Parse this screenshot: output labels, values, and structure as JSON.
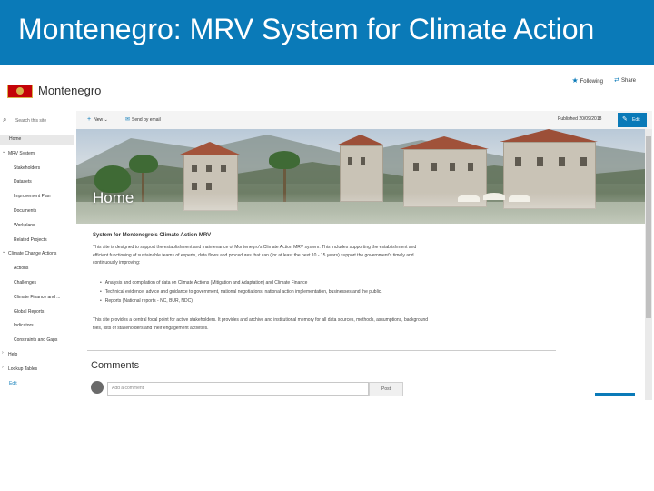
{
  "slide": {
    "title": "Montenegro: MRV System for Climate Action"
  },
  "site": {
    "name": "Montenegro"
  },
  "header": {
    "following_label": "Following",
    "share_label": "Share"
  },
  "nav": {
    "search_placeholder": "Search this site",
    "items": [
      {
        "label": "Home",
        "active": true
      },
      {
        "label": "MRV System",
        "expander": "-"
      },
      {
        "label": "Stakeholders"
      },
      {
        "label": "Datasets"
      },
      {
        "label": "Improvement Plan"
      },
      {
        "label": "Documents"
      },
      {
        "label": "Workplans"
      },
      {
        "label": "Related Projects"
      },
      {
        "label": "Climate Change Actions",
        "expander": "-"
      },
      {
        "label": "Actions"
      },
      {
        "label": "Challenges"
      },
      {
        "label": "Climate Finance and ..."
      },
      {
        "label": "Global Reports"
      },
      {
        "label": "Indicators"
      },
      {
        "label": "Constraints and Gaps"
      },
      {
        "label": "Help",
        "expander": "v"
      },
      {
        "label": "Lookup Tables",
        "expander": "v"
      },
      {
        "label": "Edit",
        "link": true
      }
    ]
  },
  "commandbar": {
    "new_label": "New",
    "send_label": "Send by email",
    "published": "Published 20/09/2018",
    "edit_label": "Edit"
  },
  "hero": {
    "title": "Home"
  },
  "content": {
    "title": "System for Montenegro's Climate Action MRV",
    "para1": [
      "This site is designed to support the establishment and maintenance of Montenegro's Climate Action MRV system. This includes supporting the establishment and",
      "efficient functioning of sustainable teams of experts, data flows and procedures that can (for at least the next 10 - 15 years) support the government's timely and",
      "continuously improving:"
    ],
    "bullets": [
      "Analysis and compilation of data on Climate Actions (Mitigation and Adaptation) and Climate Finance",
      "Technical evidence, advice and guidance to government, national negotiations, national action implementation, businesses and the public.",
      "Reports (National reports - NC, BUR, NDC)"
    ],
    "para2": [
      "This site provides a central focal point for active stakeholders. It provides and archive and institutional memory for all data sources, methods, assumptions, background",
      "files, lists of stakeholders and their engagement activities."
    ]
  },
  "comments": {
    "heading": "Comments",
    "placeholder": "Add a comment",
    "post_label": "Post"
  },
  "colors": {
    "accent": "#0a7ab8",
    "header_band": "#0a7ab8"
  }
}
